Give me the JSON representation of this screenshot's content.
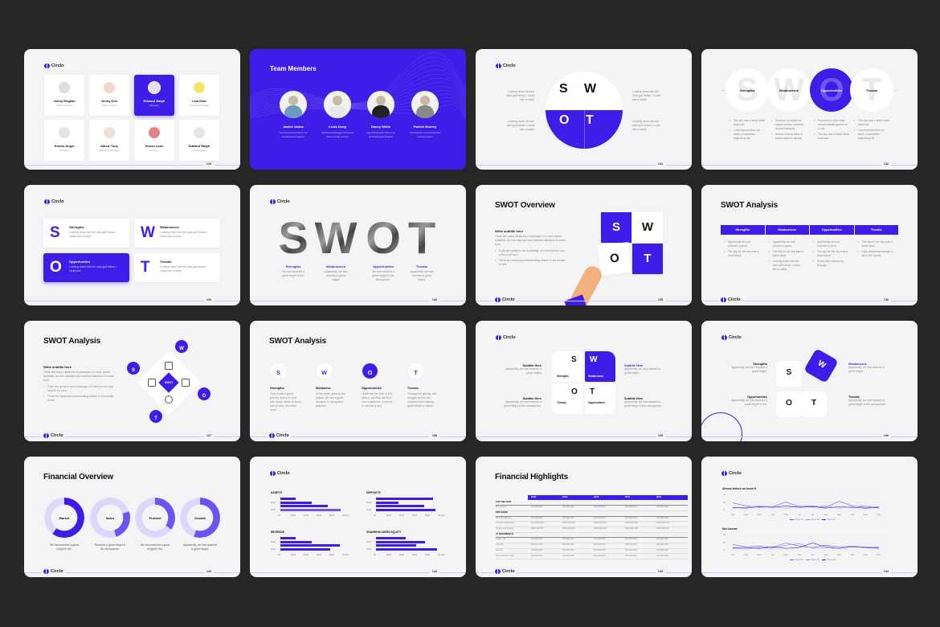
{
  "colors": {
    "background": "#262626",
    "slide": "#f4f4f6",
    "accent": "#3f1de8",
    "accent_mid": "#6a55f0",
    "accent_light": "#dcd7fb"
  },
  "brand": "Circlo",
  "slides": [
    {
      "page": "129",
      "members": [
        {
          "name": "Jonny English",
          "role": "CEO, Founder"
        },
        {
          "name": "Jenny Kim",
          "role": "CEO, Founder"
        },
        {
          "name": "Edward Ralph",
          "role": "Manager"
        },
        {
          "name": "Lisa Kate",
          "role": "Financial Manager"
        },
        {
          "name": "Kristin Angel",
          "role": "Manager"
        },
        {
          "name": "Albert Tony",
          "role": "Marketing Manager"
        },
        {
          "name": "Devon Lane",
          "role": "Designer"
        },
        {
          "name": "Edward Ralph",
          "role": "Photography"
        }
      ],
      "active_index": 2
    },
    {
      "title": "Team Members",
      "members": [
        {
          "name": "Jamen Vados",
          "role": "General Director Stem Ltd Employment Nigeria"
        },
        {
          "name": "Linda Dong",
          "role": "Marketing Manager Universal Music Group London"
        },
        {
          "name": "Danny White",
          "role": "General Director Stem Ltd Entertainment Nigeria"
        },
        {
          "name": "Patrick Monrey",
          "role": "Sound Artist Universal Music Group London"
        }
      ]
    },
    {
      "page": "131",
      "letters": [
        "S",
        "W",
        "O",
        "T"
      ],
      "texts": [
        "Looking down into the dark gulf below, I could see a ruddy",
        "Looking down into the dark gulf below, I could see a ruddy",
        "Looking down into the dark gulf below, I could see a ruddy",
        "Looking down into the dark gulf below, I could see a ruddy"
      ]
    },
    {
      "page": "132",
      "items": [
        {
          "letter": "S",
          "label": "Strengths",
          "bullets": [
            "The sky was a dead black dots had.",
            "Lorem ipsum dolor sit amet, consectetur adipiscing elit."
          ]
        },
        {
          "letter": "W",
          "label": "Weaknesses",
          "bullets": [
            "Vivamus eu neque at augue ultrices convallis sit amet tempus.",
            "Nullam viverra nulla et lectus aliquam ultrices."
          ]
        },
        {
          "letter": "O",
          "label": "Opportunities",
          "bullets": [
            "Praesent id enim vitae mauris blandit gravida ut a orci.",
            "The sky was a dead black dots had."
          ]
        },
        {
          "letter": "T",
          "label": "Threats",
          "bullets": [
            "The sky was a dead black dots had.",
            "Lorem ipsum dolor sit amet, consectetur adipiscing elit."
          ]
        }
      ]
    },
    {
      "page": "133",
      "items": [
        {
          "letter": "S",
          "label": "Strengths",
          "text": "Looking down into the dark gulf below, I could see a ruddy."
        },
        {
          "letter": "W",
          "label": "Weaknesses",
          "text": "Looking down into the dark gulf below, I could see a ruddy."
        },
        {
          "letter": "O",
          "label": "Opportunities",
          "text": "Looking down into the dark gulf below, I could see."
        },
        {
          "letter": "T",
          "label": "Threats",
          "text": "Looking down into the dark gulf below, I could see a ruddy."
        }
      ]
    },
    {
      "page": "134",
      "items": [
        {
          "letter": "S",
          "label": "Strengths",
          "text": "We had reached a great height in the."
        },
        {
          "letter": "W",
          "label": "Weaknesses",
          "text": "Apparently, we had reached a great height."
        },
        {
          "letter": "O",
          "label": "Opportunities",
          "text": "We had reached a great height in the atmosphere."
        },
        {
          "letter": "T",
          "label": "Threats",
          "text": "Apparently, we had reached a great height."
        }
      ]
    },
    {
      "page": "135",
      "title": "SWOT Overview",
      "subtitle": "Write subtitle here",
      "body": "There are many variations of passages of Lorem Ipsum available, but the majority have suffered alteration in some form.",
      "bullets": [
        "If you are going to use a passage of Lorem Ipsum, you need to be sure.",
        "There isn't anything embarrassing hidden in the middle of text."
      ],
      "letters": [
        "S",
        "W",
        "O",
        "T"
      ]
    },
    {
      "page": "136",
      "title": "SWOT Analysis",
      "columns": [
        {
          "label": "Strengths",
          "bullets": [
            "Apparently we had reached a great.",
            "The sky for the sky was a dead black."
          ]
        },
        {
          "label": "Weaknesses",
          "bullets": [
            "Apparently we had reached a great.",
            "The sky for the sky was a dead black.",
            "Looking down into the dark gulf below, I could see a ruddy."
          ]
        },
        {
          "label": "Opportunities",
          "bullets": [
            "Apparently we had reached a great.",
            "The sky for the sky was a dead black.",
            "Ruddy light streaming through."
          ]
        },
        {
          "label": "Threats",
          "bullets": [
            "The sky for the sky was a dead black.",
            "Light streaming through a rift in the clouds."
          ]
        }
      ]
    },
    {
      "page": "137",
      "title": "SWOT Analysis",
      "subtitle": "Write subtitle here",
      "body": "There are many variations of passages of Lorem Ipsum available, but the majority have suffered alteration in some form.",
      "bullets": [
        "If you are going to use a passage of Lorem Ipsum, you need to be sure.",
        "There isn't anything embarrassing hidden in the middle of text."
      ],
      "center": "SWOT",
      "letters": [
        "S",
        "W",
        "O",
        "T"
      ]
    },
    {
      "page": "138",
      "title": "SWOT Analysis",
      "items": [
        {
          "letter": "S",
          "label": "Strengths",
          "text": "Truly it was a great journey, and in it I met with many, whom to know was to love; but which never."
        },
        {
          "letter": "W",
          "label": "Weakness",
          "text": "At the noble gates of the palace, we had a great treasure. In my space I watched."
        },
        {
          "letter": "O",
          "label": "Opportunities",
          "text": "I shall see the face of Dirt, stories, and that will be a new experience. It seems to me that a new."
        },
        {
          "letter": "T",
          "label": "Threats",
          "text": "Through the gravity, still dragged at him, his muscles were making great efforts to adjust."
        }
      ]
    },
    {
      "page": "139",
      "tiles": [
        {
          "letter": "S",
          "label": "Strengths"
        },
        {
          "letter": "W",
          "label": "Weaknesses"
        },
        {
          "letter": "O",
          "label": "Threats"
        },
        {
          "letter": "T",
          "label": "Opportunities"
        }
      ],
      "notes": [
        {
          "title": "Subtitle Here",
          "text": "Apparently, we had reached a great height."
        },
        {
          "title": "Subtitle Here",
          "text": "Apparently, we had reached a great height."
        },
        {
          "title": "Subtitle Here",
          "text": "Apparently, we had reached a great height in the atmosphere."
        },
        {
          "title": "Subtitle Here",
          "text": "Apparently, we had reached a great height in the atmosphere."
        }
      ]
    },
    {
      "page": "140",
      "letters": [
        "S",
        "W",
        "O",
        "T"
      ],
      "notes": [
        {
          "title": "Strengths",
          "text": "Apparently, we had reached a great height."
        },
        {
          "title": "Weaknesses",
          "text": "Apparently, we had reached a great height."
        },
        {
          "title": "Opportunities",
          "text": "Apparently, we had reached a great height in the."
        },
        {
          "title": "Threats",
          "text": "Apparently, we had reached a great height in the atmosphere."
        }
      ]
    },
    {
      "page": "141",
      "title": "Financial Overview",
      "donuts": [
        {
          "label": "Market",
          "percent": 60,
          "start": 0,
          "caption": "We had reached a great height in the."
        },
        {
          "label": "Sales",
          "percent": 25,
          "start": 20,
          "caption": "Reached a great height in the atmosphere."
        },
        {
          "label": "Product",
          "percent": 35,
          "start": 65,
          "caption": "We had reached a great height in the."
        },
        {
          "label": "Growth",
          "percent": 55,
          "start": 0,
          "caption": "Apparently, we had reached a great height."
        }
      ]
    },
    {
      "page": "142",
      "charts": [
        {
          "title": "ASSETS",
          "years": [
            "2019",
            "2020"
          ],
          "ticks": [
            "$0",
            "$200",
            "$400",
            "$600",
            "$800",
            "$1000"
          ],
          "values": [
            240,
            490,
            735,
            940
          ]
        },
        {
          "title": "DEPOSITS",
          "years": [
            "2019",
            "2020"
          ],
          "ticks": [
            "$0",
            "$200",
            "$400",
            "$600",
            "$800",
            "$1,000"
          ],
          "values": [
            890,
            355,
            750,
            930
          ]
        },
        {
          "title": "REVENUE",
          "years": [
            "2019",
            "2020"
          ],
          "ticks": [
            "$0",
            "$200",
            "$400",
            "$600",
            "$800",
            "$1000"
          ],
          "values": [
            240,
            490,
            930,
            770
          ]
        },
        {
          "title": "SHAREHOLDERS EQUITY",
          "years": [
            "2019",
            "2020"
          ],
          "ticks": [
            "$0",
            "$200",
            "$400",
            "$600",
            "$800",
            "$1,000"
          ],
          "values": [
            460,
            760,
            630,
            945
          ]
        }
      ]
    },
    {
      "page": "143",
      "title": "Financial Highlights",
      "header": [
        "",
        "2020",
        "2019",
        "2018",
        "2017",
        "2016"
      ],
      "rows": [
        {
          "section": "FOR THE YEAR"
        },
        {
          "cells": [
            "Net income",
            "$10,000,000",
            "$10,000,000",
            "$10,000,000",
            "$10,000,000",
            "$10,000,000"
          ]
        },
        {
          "section": "PER SHARE"
        },
        {
          "cells": [
            "Earning (Diluted)",
            "$10,000,000",
            "$10,000,000",
            "$10,000,000",
            "$10,000,000",
            "$10,000,000"
          ]
        },
        {
          "cells": [
            "Tangible book value",
            "$100,000,000",
            "$100,000,000",
            "$100,000,000",
            "$100,000,000",
            "$100,000,000"
          ]
        },
        {
          "cells": [
            "Shares outstanding",
            "$250,000,000",
            "$250,000,000",
            "$250,000,000",
            "$250,000,000",
            "$250,000,000"
          ]
        },
        {
          "section": "AT DECEMBER 31"
        },
        {
          "cells": [
            "Loans, net",
            "$10,000,000",
            "$10,000,000",
            "$10,000,000",
            "$10,000,000",
            "$10,000,000"
          ]
        },
        {
          "cells": [
            "Deposits",
            "$48,000,000",
            "$48,000,000",
            "$48,000,000",
            "$48,000,000",
            "$48,000,000"
          ]
        },
        {
          "cells": [
            "Assets",
            "$10,000,000",
            "$10,000,000",
            "$10,000,000",
            "$10,000,000",
            "$10,000,000"
          ]
        },
        {
          "cells": [
            "Shareholders equity",
            "$10,000,000",
            "$10,000,000",
            "$10,000,000",
            "$10,000,000",
            "$10,000,000"
          ]
        }
      ]
    },
    {
      "page": "144",
      "charts": [
        {
          "title": "Almost before we knew it",
          "type": "line",
          "x": [
            "Jan",
            "Feb",
            "Mar",
            "Apr",
            "May",
            "Jun",
            "Jul",
            "Aug",
            "Sep",
            "Oct",
            "Nov",
            "Dec"
          ],
          "yticks": [
            "20",
            "10",
            "0"
          ],
          "ylim": [
            0,
            20
          ],
          "series": [
            {
              "name": "Value #1",
              "values": [
                10,
                6,
                4,
                5,
                11,
                5,
                6,
                4,
                12,
                6,
                4,
                5
              ]
            },
            {
              "name": "Value #2",
              "values": [
                3,
                4,
                6,
                5,
                3,
                6,
                4,
                6,
                3,
                5,
                6,
                3
              ]
            },
            {
              "name": "Value #3",
              "values": [
                4,
                3,
                5,
                4,
                6,
                4,
                5,
                3,
                5,
                4,
                3,
                4
              ]
            }
          ]
        },
        {
          "title": "Net income",
          "type": "line",
          "x": [
            "Jan",
            "Feb",
            "Mar",
            "Apr",
            "May",
            "Jun",
            "Jul",
            "Aug",
            "Sep",
            "Oct",
            "Nov",
            "Dec"
          ],
          "yticks": [
            "20",
            "10",
            "0"
          ],
          "ylim": [
            0,
            20
          ],
          "series": [
            {
              "name": "Value #1",
              "values": [
                8,
                5,
                6,
                4,
                10,
                6,
                4,
                7,
                5,
                6,
                4,
                5
              ]
            },
            {
              "name": "Value #2",
              "values": [
                3,
                2,
                4,
                3,
                7,
                9,
                3,
                4,
                3,
                5,
                5,
                4
              ]
            },
            {
              "name": "Value #3",
              "values": [
                4,
                4,
                3,
                5,
                3,
                4,
                10,
                5,
                3,
                5,
                4,
                3
              ]
            }
          ]
        }
      ]
    }
  ]
}
